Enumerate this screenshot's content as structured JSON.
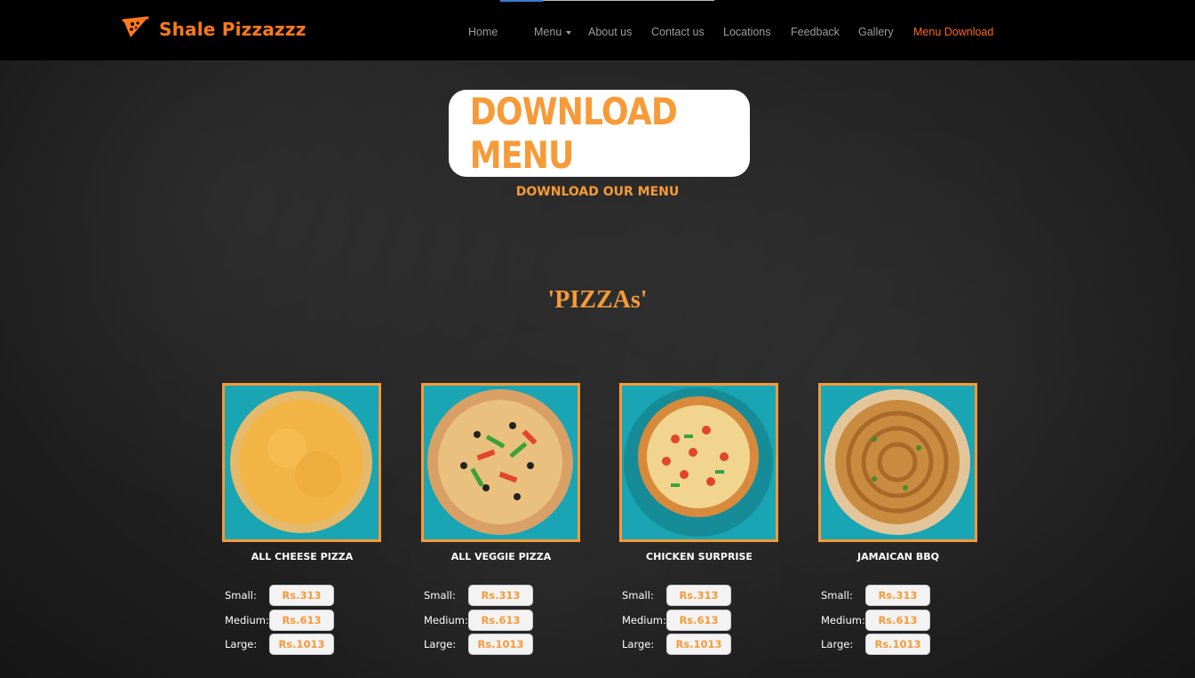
{
  "brand": {
    "name": "Shale Pizzazzz"
  },
  "nav": {
    "items": [
      {
        "label": "Home"
      },
      {
        "label": "Menu"
      },
      {
        "label": "About us"
      },
      {
        "label": "Contact us"
      },
      {
        "label": "Locations"
      },
      {
        "label": "Feedback"
      },
      {
        "label": "Gallery"
      },
      {
        "label": "Menu Download"
      }
    ],
    "active": "Menu Download"
  },
  "hero": {
    "download_button": "DOWNLOAD MENU",
    "download_link": "DOWNLOAD OUR MENU"
  },
  "section": {
    "title": "'PIZZAs'"
  },
  "pizzas": [
    {
      "name": "ALL CHEESE PIZZA",
      "prices": [
        {
          "size": "Small:",
          "price": "Rs.313"
        },
        {
          "size": "Medium:",
          "price": "Rs.613"
        },
        {
          "size": "Large:",
          "price": "Rs.1013"
        }
      ]
    },
    {
      "name": "ALL VEGGIE PIZZA",
      "prices": [
        {
          "size": "Small:",
          "price": "Rs.313"
        },
        {
          "size": "Medium:",
          "price": "Rs.613"
        },
        {
          "size": "Large:",
          "price": "Rs.1013"
        }
      ]
    },
    {
      "name": "CHICKEN SURPRISE",
      "prices": [
        {
          "size": "Small:",
          "price": "Rs.313"
        },
        {
          "size": "Medium:",
          "price": "Rs.613"
        },
        {
          "size": "Large:",
          "price": "Rs.1013"
        }
      ]
    },
    {
      "name": "JAMAICAN BBQ",
      "prices": [
        {
          "size": "Small:",
          "price": "Rs.313"
        },
        {
          "size": "Medium:",
          "price": "Rs.613"
        },
        {
          "size": "Large:",
          "price": "Rs.1013"
        }
      ]
    }
  ],
  "colors": {
    "accent": "#f79a38",
    "brand": "#ff7a1a",
    "nav_active": "#ff6a14",
    "image_bg": "#1aa3b0"
  },
  "icons": {
    "logo": "pizza-slice-icon"
  }
}
